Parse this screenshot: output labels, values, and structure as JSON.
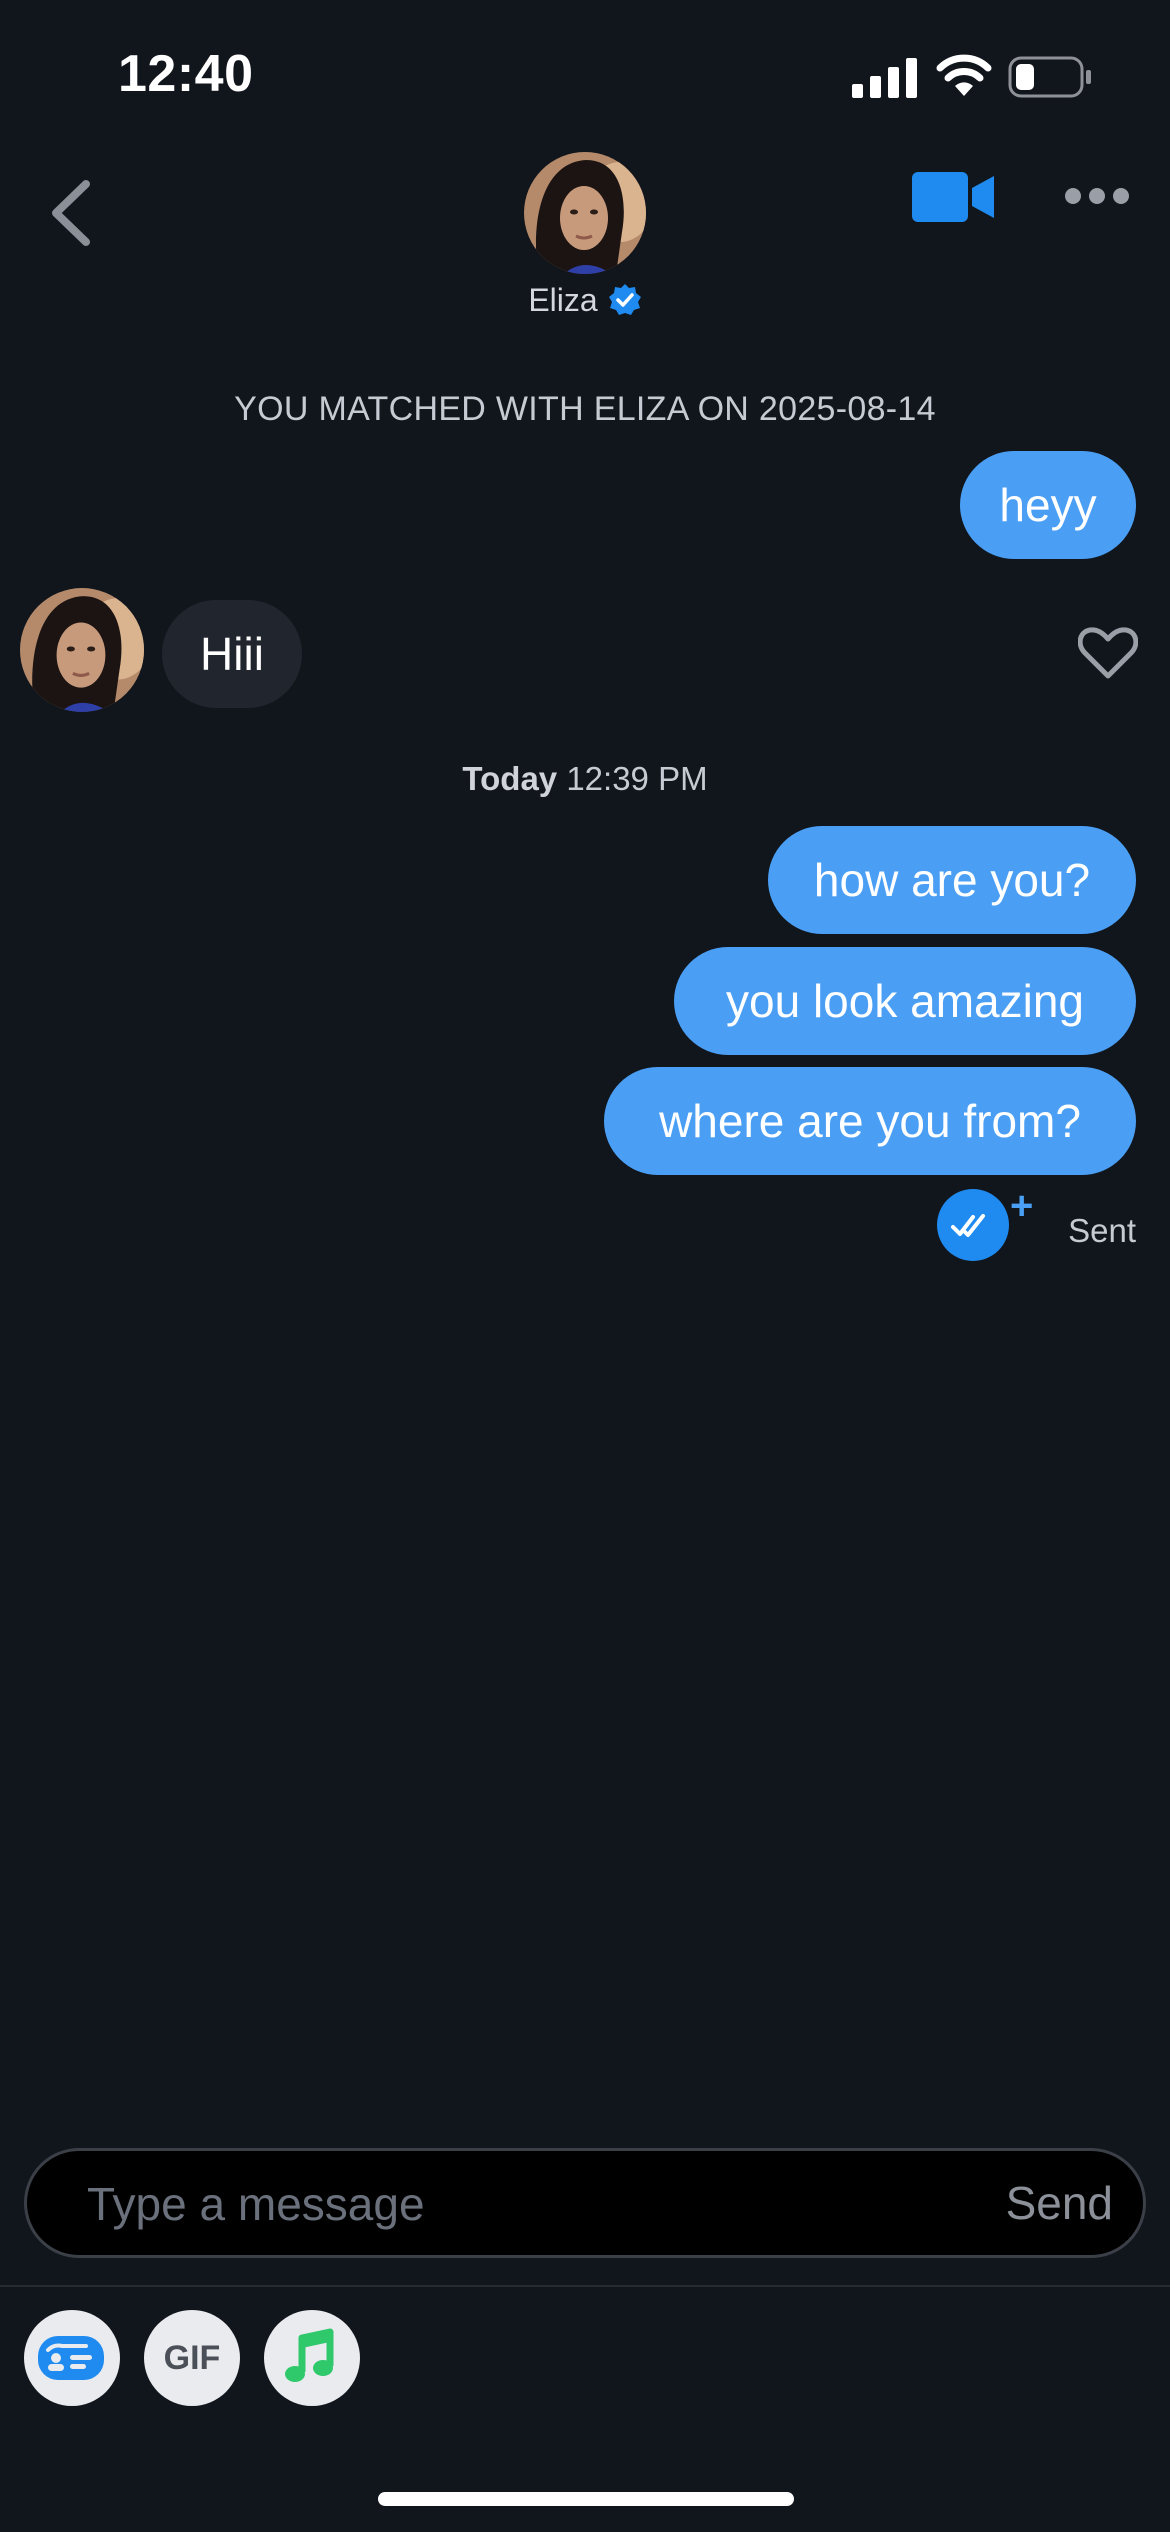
{
  "status_bar": {
    "time": "12:40"
  },
  "header": {
    "name": "Eliza",
    "verified": true,
    "icons": [
      "back-icon",
      "video-call-icon",
      "more-icon",
      "verified-icon"
    ]
  },
  "conversation": {
    "match_label": "YOU MATCHED WITH ELIZA ON 2025-08-14",
    "messages": [
      {
        "direction": "outgoing",
        "text": "heyy"
      },
      {
        "direction": "incoming",
        "text": "Hiii"
      },
      {
        "direction": "outgoing",
        "text": "how are you?"
      },
      {
        "direction": "outgoing",
        "text": "you look amazing"
      },
      {
        "direction": "outgoing",
        "text": "where are you from?"
      }
    ],
    "day_separator": {
      "day": "Today",
      "time": "12:39 PM"
    },
    "receipt": {
      "plus": "+",
      "status": "Sent"
    }
  },
  "composer": {
    "placeholder": "Type a message",
    "value": "",
    "send_label": "Send"
  },
  "toolbar": {
    "gif_label": "GIF",
    "icons": [
      "card-icon",
      "gif-icon",
      "music-icon"
    ]
  },
  "colors": {
    "background": "#11151c",
    "accent": "#4a9ff5",
    "incoming_bubble": "#21262e",
    "music_green": "#2fc86b"
  }
}
